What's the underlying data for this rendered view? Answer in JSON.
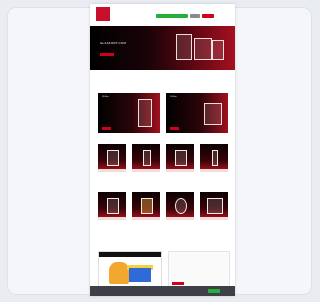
{
  "header": {
    "logo_text": "",
    "nav": [
      "",
      "",
      "",
      ""
    ],
    "phone_button": "",
    "gray_button": "",
    "red_button": ""
  },
  "hero": {
    "title": "GLASFORT.COM",
    "subtitle": "",
    "subtitle2": "",
    "cta": ""
  },
  "breadcrumb": "",
  "sections": {
    "intro_title": "",
    "panel_left_label": "3D Glas",
    "panel_right_label": "2D Glas",
    "products_title": "",
    "products2_title": "",
    "video_title": ""
  },
  "cookie": {
    "text": "",
    "accept": ""
  },
  "colors": {
    "brand_red": "#c8102e",
    "accent_green": "#27ae3a",
    "banner_gray": "#3d4046"
  },
  "icons": [
    "logo",
    "phone-icon",
    "crystal-product-image"
  ]
}
